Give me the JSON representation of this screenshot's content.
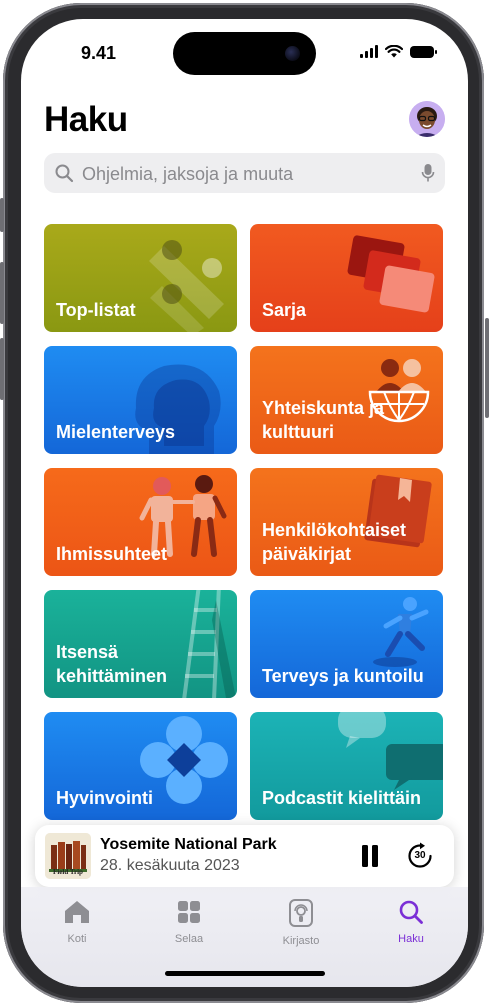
{
  "status": {
    "time": "9.41"
  },
  "header": {
    "title": "Haku"
  },
  "search": {
    "placeholder": "Ohjelmia, jaksoja ja muuta"
  },
  "categories": [
    {
      "label": "Top-listat",
      "color": "#8f9c15"
    },
    {
      "label": "Sarja",
      "color": "#ef4a1c"
    },
    {
      "label": "Mielenterveys",
      "color": "#1c7cea"
    },
    {
      "label": "Yhteiskunta ja kulttuuri",
      "color": "#f06419"
    },
    {
      "label": "Ihmissuhteet",
      "color": "#f2601c"
    },
    {
      "label": "Henkilökohtaiset päiväkirjat",
      "color": "#f06419"
    },
    {
      "label": "Itsensä kehittäminen",
      "color": "#19a48e"
    },
    {
      "label": "Terveys ja kuntoilu",
      "color": "#1a7ee8"
    },
    {
      "label": "Hyvinvointi",
      "color": "#1c7cea"
    },
    {
      "label": "Podcastit kielittäin",
      "color": "#18a6ab"
    }
  ],
  "now_playing": {
    "title": "Yosemite National Park",
    "subtitle": "28. kesäkuuta 2023",
    "artwork_text": "Field Trip",
    "skip_seconds": "30"
  },
  "tabs": [
    {
      "label": "Koti",
      "icon": "home-icon"
    },
    {
      "label": "Selaa",
      "icon": "grid-icon"
    },
    {
      "label": "Kirjasto",
      "icon": "library-icon"
    },
    {
      "label": "Haku",
      "icon": "search-icon",
      "active": true
    }
  ],
  "colors": {
    "accent": "#7b2fd6"
  }
}
